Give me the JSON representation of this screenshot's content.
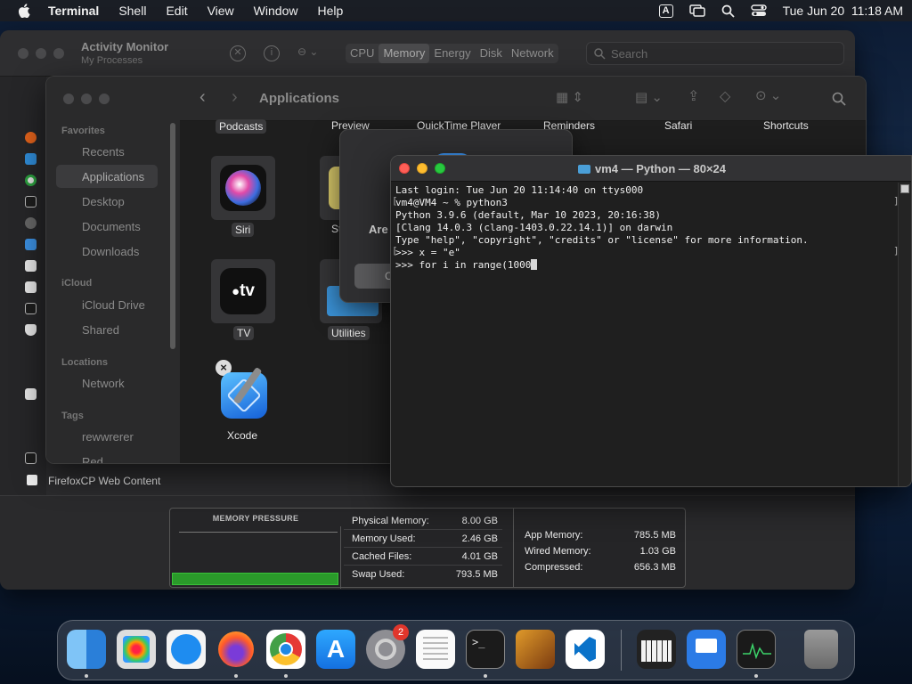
{
  "menubar": {
    "app": "Terminal",
    "items": [
      "Shell",
      "Edit",
      "View",
      "Window",
      "Help"
    ],
    "input_badge": "A",
    "datetime": "Tue Jun 20  11:18 AM"
  },
  "activity_monitor": {
    "title": "Activity Monitor",
    "subtitle": "My Processes",
    "tabs": [
      "CPU",
      "Memory",
      "Energy",
      "Disk",
      "Network"
    ],
    "selected_tab": "Memory",
    "search_placeholder": "Search",
    "visible_process": "FirefoxCP Web Content",
    "memory_pressure_title": "MEMORY PRESSURE",
    "stats_left": [
      {
        "label": "Physical Memory:",
        "value": "8.00 GB"
      },
      {
        "label": "Memory Used:",
        "value": "2.46 GB"
      },
      {
        "label": "Cached Files:",
        "value": "4.01 GB"
      },
      {
        "label": "Swap Used:",
        "value": "793.5 MB"
      }
    ],
    "stats_right": [
      {
        "label": "App Memory:",
        "value": "785.5 MB"
      },
      {
        "label": "Wired Memory:",
        "value": "1.03 GB"
      },
      {
        "label": "Compressed:",
        "value": "656.3 MB"
      }
    ]
  },
  "finder": {
    "title": "Applications",
    "sidebar": {
      "favorites_header": "Favorites",
      "favorites": [
        "Recents",
        "Applications",
        "Desktop",
        "Documents",
        "Downloads"
      ],
      "icloud_header": "iCloud",
      "icloud": [
        "iCloud Drive",
        "Shared"
      ],
      "locations_header": "Locations",
      "locations": [
        "Network"
      ],
      "tags_header": "Tags",
      "tags": [
        "rewwrerer",
        "Red"
      ]
    },
    "top_row_labels": [
      "Podcasts",
      "Preview",
      "QuickTime Player",
      "Reminders",
      "Safari",
      "Shortcuts"
    ],
    "apps": [
      {
        "label": "Siri"
      },
      {
        "label": "TV"
      },
      {
        "label": "Utilities"
      },
      {
        "label": "Xcode"
      }
    ],
    "partial_label": "St",
    "tv_logo": "tv"
  },
  "dialog": {
    "partial_text": "Are",
    "button_partial": "C"
  },
  "terminal": {
    "title": "vm4 — Python — 80×24",
    "lines": [
      "Last login: Tue Jun 20 11:14:40 on ttys000",
      "vm4@VM4 ~ % python3",
      "Python 3.9.6 (default, Mar 10 2023, 20:16:38)",
      "[Clang 14.0.3 (clang-1403.0.22.14.1)] on darwin",
      "Type \"help\", \"copyright\", \"credits\" or \"license\" for more information.",
      ">>> x = \"e\"",
      ">>> for i in range(1000"
    ]
  },
  "dock": {
    "apps": [
      "Finder",
      "Launchpad",
      "Safari",
      "Firefox",
      "Chrome",
      "App Store",
      "System Settings",
      "TextEdit",
      "Terminal",
      "GarageBand",
      "Visual Studio Code",
      "Piano",
      "Keynote",
      "Activity Monitor",
      "Trash"
    ],
    "settings_badge": "2"
  }
}
